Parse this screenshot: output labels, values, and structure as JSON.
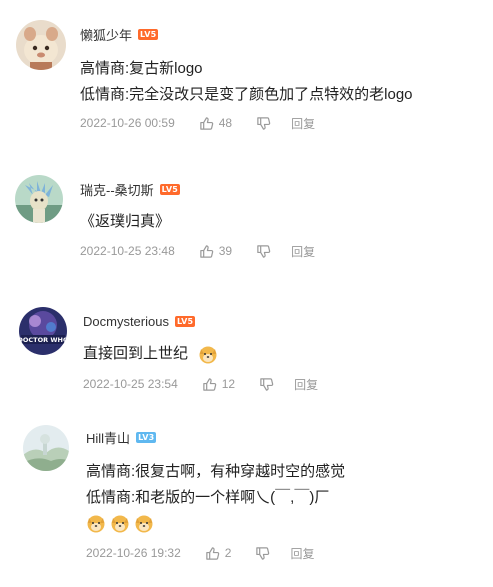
{
  "comments": [
    {
      "username": "懒狐少年",
      "level": "LV5",
      "lines": [
        "高情商:复古新logo",
        "低情商:完全没改只是变了颜色加了点特效的老logo"
      ],
      "time": "2022-10-26 00:59",
      "likes": "48",
      "reply_label": "回复"
    },
    {
      "username": "瑞克--桑切斯",
      "level": "LV5",
      "lines": [
        "《返璞归真》"
      ],
      "time": "2022-10-25 23:48",
      "likes": "39",
      "reply_label": "回复"
    },
    {
      "username": "Docmysterious",
      "level": "LV5",
      "lines": [
        "直接回到上世纪"
      ],
      "time": "2022-10-25 23:54",
      "likes": "12",
      "reply_label": "回复"
    },
    {
      "username": "Hill青山",
      "level": "LV3",
      "lines": [
        "高情商:很复古啊，有种穿越时空的感觉",
        "低情商:和老版的一个样啊乀(￣,￣)厂"
      ],
      "time": "2022-10-26 19:32",
      "likes": "2",
      "reply_label": "回复"
    }
  ],
  "colors": {
    "level_orange": "#ff6a2b",
    "level_blue": "#5fb8f0",
    "meta_gray": "#999999"
  },
  "icons": [
    "thumbs-up-icon",
    "thumbs-down-icon",
    "doge-emoji"
  ]
}
